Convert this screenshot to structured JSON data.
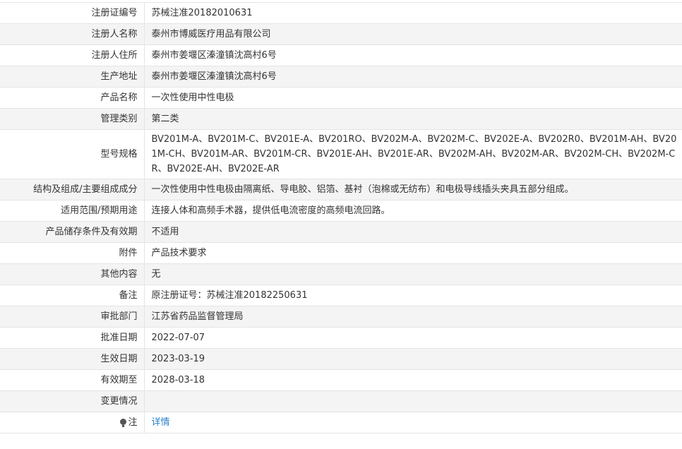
{
  "rows": [
    {
      "label": "注册证编号",
      "value": "苏械注准20182010631"
    },
    {
      "label": "注册人名称",
      "value": "泰州市博威医疗用品有限公司"
    },
    {
      "label": "注册人住所",
      "value": "泰州市姜堰区溱潼镇沈高村6号"
    },
    {
      "label": "生产地址",
      "value": "泰州市姜堰区溱潼镇沈高村6号"
    },
    {
      "label": "产品名称",
      "value": "一次性使用中性电极"
    },
    {
      "label": "管理类别",
      "value": "第二类"
    },
    {
      "label": "型号规格",
      "value": "BV201M-A、BV201M-C、BV201E-A、BV201RO、BV202M-A、BV202M-C、BV202E-A、BV202R0、BV201M-AH、BV201M-CH、BV201M-AR、BV201M-CR、BV201E-AH、BV201E-AR、BV202M-AH、BV202M-AR、BV202M-CH、BV202M-CR、BV202E-AH、BV202E-AR"
    },
    {
      "label": "结构及组成/主要组成成分",
      "value": "一次性使用中性电极由隔离纸、导电胶、铝箔、基衬（泡棉或无纺布）和电极导线插头夹具五部分组成。"
    },
    {
      "label": "适用范围/预期用途",
      "value": "连接人体和高频手术器，提供低电流密度的高频电流回路。"
    },
    {
      "label": "产品储存条件及有效期",
      "value": "不适用"
    },
    {
      "label": "附件",
      "value": "产品技术要求"
    },
    {
      "label": "其他内容",
      "value": "无"
    },
    {
      "label": "备注",
      "value": "原注册证号：苏械注准20182250631"
    },
    {
      "label": "审批部门",
      "value": "江苏省药品监督管理局"
    },
    {
      "label": "批准日期",
      "value": "2022-07-07"
    },
    {
      "label": "生效日期",
      "value": "2023-03-19"
    },
    {
      "label": "有效期至",
      "value": "2028-03-18"
    },
    {
      "label": "变更情况",
      "value": ""
    }
  ],
  "note": {
    "label": "注",
    "link_text": "详情",
    "icon": "lightbulb-icon"
  }
}
